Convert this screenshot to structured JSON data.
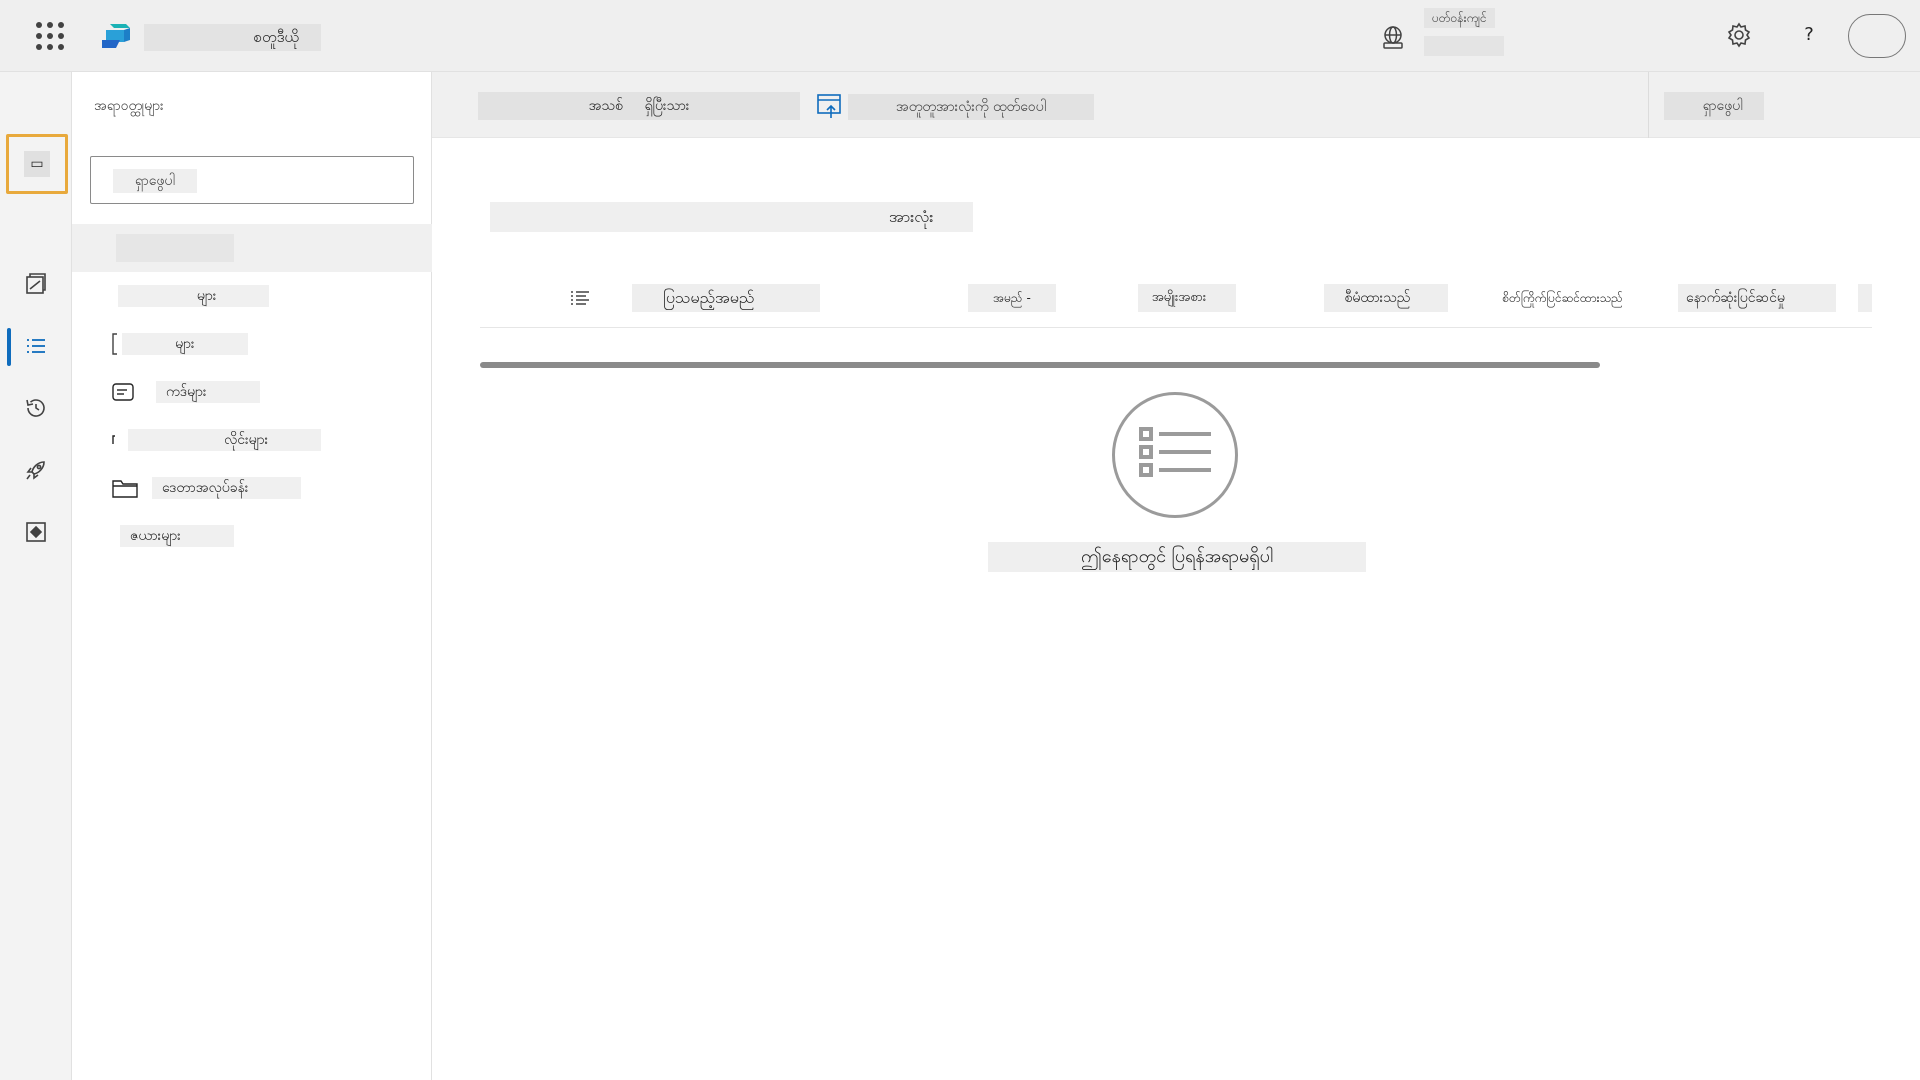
{
  "topbar": {
    "app_title": "ᅟᅟᅟᅟᅟᅟ စတူဒီယို",
    "env_label": "ပတ်ဝန်းကျင်",
    "env_name": "ᅟᅟᅟᅟᅟᅟ",
    "help": "?",
    "avatar": "ᅟᅟ ᅟ"
  },
  "rail": {
    "collapse": "ᅟ",
    "highlighted_glyph": "▭",
    "small_label": "ᅟᅟᅟ"
  },
  "sidepanel": {
    "heading": "အရာဝတ္ထုများ",
    "heading_btn": "ᅟ",
    "search_placeholder": "ရှာဖွေပါ",
    "all_label": "ᅟᅟᅟ ᅟᅟᅟ",
    "items": [
      {
        "label": "ᅟᅟᅟᅟᅟ များ ᅟᅟᅟ",
        "icon": "none"
      },
      {
        "label": "ᅟᅟᅟ များ ᅟᅟᅟ",
        "icon": "bracket-icon"
      },
      {
        "label": "ကဒ်များ ᅟᅟᅟ",
        "icon": "card-icon"
      },
      {
        "label": "ᅟ ᅟᅟᅟᅟᅟ လိုင်းများ ᅟᅟᅟ",
        "icon": "none"
      },
      {
        "label": "ဒေတာအလုပ်ခန်း ᅟᅟᅟ",
        "icon": "folder-icon"
      },
      {
        "label": "ဇယားများ ᅟᅟᅟ",
        "icon": "none"
      }
    ]
  },
  "commandbar": {
    "new_label": "ᅟ အသစ် ᅟ ရှိပြီးသား ᅟ",
    "export_label": "အတူတူအားလုံးကို ထုတ်ဝေပါ",
    "search_label": "ᅟ ရှာဖွေပါ"
  },
  "main": {
    "view_title": "ᅟᅟᅟᅟᅟᅟᅟ ᅟᅟᅟᅟᅟᅟᅟᅟ ᅟᅟᅟᅟᅟᅟᅟ ᅟ အားလုံး",
    "columns": {
      "display_name": "ပြသမည့်အမည် ᅟᅟ",
      "name": "အမည် -",
      "type": "အမျိုးအစား ᅟ",
      "managed": "စီမံထားသည် ᅟ",
      "customized": "စိတ်ကြိုက်ပြင်ဆင်ထားသည် ᅟ",
      "modified": "နောက်ဆုံးပြင်ဆင်မှု ᅟᅟᅟ ᅟ",
      "more": "ᅟ"
    },
    "empty_text": "ဤနေရာတွင် ပြရန်အရာမရှိပါ"
  },
  "colors": {
    "accent": "#0f6cbd",
    "highlight": "#e8a93c",
    "logo_teal": "#1bb2b5",
    "logo_blue": "#2266c7"
  }
}
